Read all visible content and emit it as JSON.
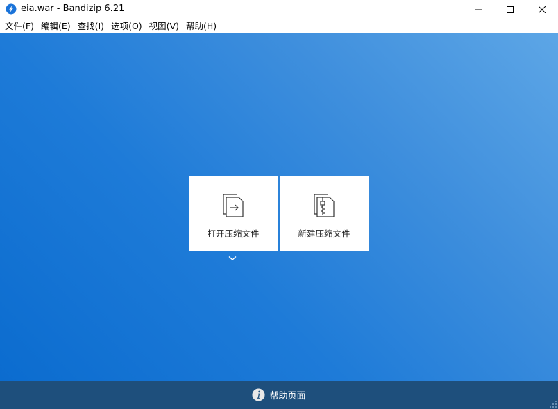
{
  "window": {
    "title": "eia.war - Bandizip 6.21",
    "app_icon": "bandizip-logo-icon",
    "controls": {
      "minimize": "minimize-icon",
      "maximize": "maximize-icon",
      "close": "close-icon"
    }
  },
  "menubar": {
    "items": [
      {
        "label": "文件(F)"
      },
      {
        "label": "编辑(E)"
      },
      {
        "label": "查找(I)"
      },
      {
        "label": "选项(O)"
      },
      {
        "label": "视图(V)"
      },
      {
        "label": "帮助(H)"
      }
    ]
  },
  "main": {
    "open_card": {
      "label": "打开压缩文件",
      "icon": "open-archive-icon"
    },
    "new_card": {
      "label": "新建压缩文件",
      "icon": "new-archive-icon"
    },
    "more_icon": "chevron-down-icon"
  },
  "footer": {
    "help_label": "帮助页面",
    "help_icon": "info-icon"
  },
  "colors": {
    "main_gradient_light": "#5da6e6",
    "main_gradient_dark": "#0b6ccf",
    "footer_bg": "#1e4f7c",
    "card_bg": "#ffffff",
    "logo_blue": "#1a73d9"
  }
}
